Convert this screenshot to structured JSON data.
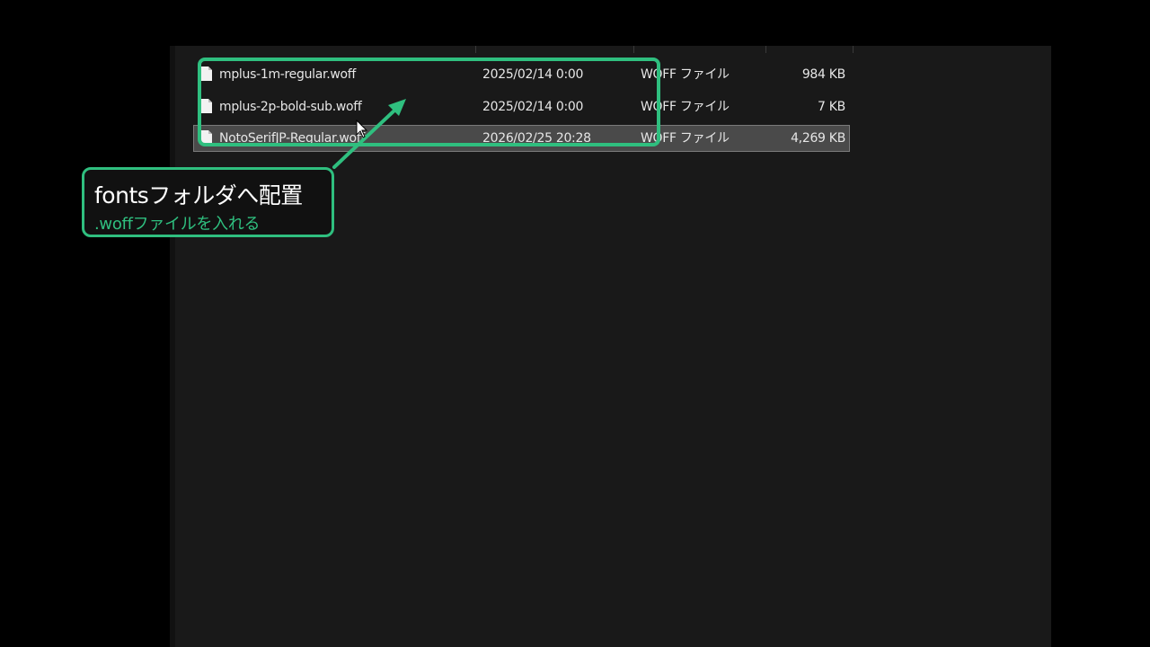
{
  "files": [
    {
      "name": "mplus-1m-regular.woff",
      "date": "2025/02/14 0:00",
      "type": "WOFF ファイル",
      "size": "984 KB",
      "selected": false
    },
    {
      "name": "mplus-2p-bold-sub.woff",
      "date": "2025/02/14 0:00",
      "type": "WOFF ファイル",
      "size": "7 KB",
      "selected": false
    },
    {
      "name": "NotoSerifJP-Regular.woff",
      "date": "2026/02/25 20:28",
      "type": "WOFF ファイル",
      "size": "4,269 KB",
      "selected": true
    }
  ],
  "callout": {
    "title": "fontsフォルダへ配置",
    "subtitle": ".woffファイルを入れる"
  },
  "colors": {
    "accent": "#2fbf7f",
    "explorer_bg": "#191919",
    "selected_bg": "#4a4a4a",
    "text": "#e6e6e6"
  },
  "icons": {
    "file": "file-icon",
    "cursor": "mouse-cursor-icon",
    "arrow": "annotation-arrow"
  }
}
